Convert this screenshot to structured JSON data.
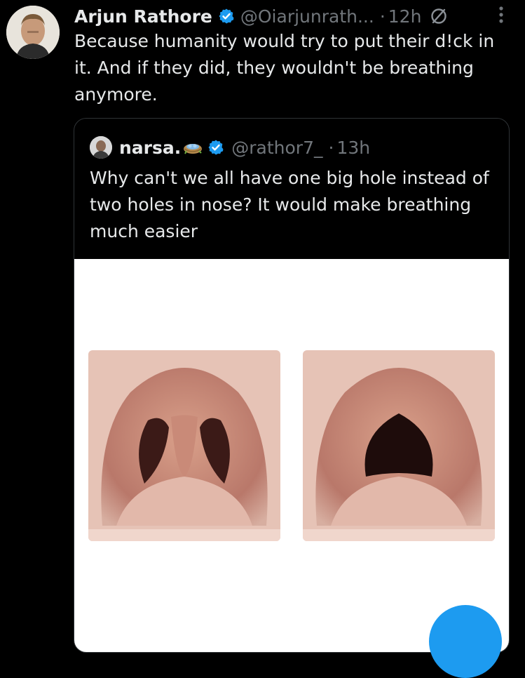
{
  "tweet": {
    "author_name": "Arjun Rathore",
    "handle": "@Oiarjunrath...",
    "separator": "·",
    "time": "12h",
    "text": "Because humanity would try to put their d!ck in it. And if they did, they wouldn't be breathing anymore."
  },
  "quoted": {
    "author_name": "narsa.",
    "handle": "@rathor7_",
    "separator": "·",
    "time": "13h",
    "text": "Why can't we all have one big hole instead of two holes in nose? It would make breathing much easier"
  },
  "colors": {
    "background": "#000000",
    "text": "#e7e9ea",
    "muted": "#71767b",
    "verified": "#1d9bf0",
    "border": "#2f3336",
    "fab": "#1d9bf0"
  },
  "icons": [
    "verified-badge-icon",
    "no-entry-icon",
    "more-options-icon",
    "nest-emoji-icon"
  ]
}
